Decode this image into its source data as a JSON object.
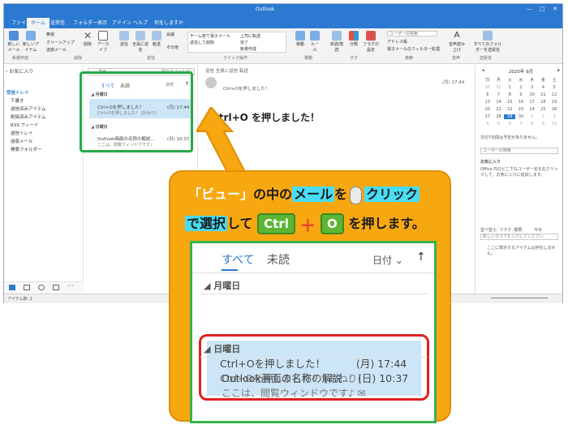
{
  "window": {
    "title": "Outlook",
    "controls": [
      "—",
      "□",
      "✕"
    ]
  },
  "tabs": [
    "ファイル",
    "ホーム",
    "送受信",
    "フォルダー",
    "表示",
    "アドイン",
    "ヘルプ",
    "何をしますか"
  ],
  "ribbon": {
    "new_mail": "新しいメール",
    "new_items": "新しいアイテム",
    "group_new": "新規作成",
    "ignore": "無視",
    "cleanup": "クリーンアップ",
    "junk": "迷惑メール",
    "delete": "削除",
    "archive": "アーカイブ",
    "group_delete": "削除",
    "reply": "返信",
    "reply_all": "全員に返信",
    "forward": "転送",
    "meeting": "会議",
    "more": "その他",
    "group_respond": "返信",
    "quick_to_manager": "上司に転送",
    "quick_team": "チーム宛て電子メール",
    "quick_done": "完了",
    "quick_reply_delete": "返信して削除",
    "quick_new": "新規作成",
    "group_quick": "クイック操作",
    "move": "移動",
    "rules": "ルール",
    "group_move": "移動",
    "unread": "未読/既読",
    "categorize": "分類",
    "followup": "フラグの設定",
    "group_tags": "タグ",
    "search_people": "ユーザーの検索",
    "address_book": "アドレス帳",
    "filter_email": "電子メールのフィルター処理",
    "group_find": "検索",
    "read_aloud": "音声読み上げ",
    "group_speech": "音声",
    "send_receive_all": "すべてのフォルダーを送受信",
    "group_send_receive": "送受信"
  },
  "folders": {
    "favorites": "お気に入り",
    "items": [
      "受信トレイ",
      "下書き",
      "送信済みアイテム",
      "削除済みアイテム",
      "RSS フィード",
      "送信トレイ",
      "迷惑メール",
      "検索フォルダー"
    ]
  },
  "status": {
    "items": "アイテム数: 2"
  },
  "message_list": {
    "search_placeholder": "検索",
    "search_scope": "現在のフォルダー",
    "filter_all": "すべて",
    "filter_unread": "未読",
    "sort_by": "日付",
    "groups": [
      {
        "label": "月曜日",
        "sender": "Ctrl+Oを押しました！",
        "preview": "Ctrl+Oを押しました！ [おわり]",
        "time": "(月) 17:44"
      },
      {
        "label": "日曜日",
        "sender": "Outlook画面の名称の解説…",
        "preview": "ここは、閲覧ウィンドウです♪",
        "time": "(日) 10:37"
      }
    ]
  },
  "reading": {
    "toolbar": "返信   全員に返信   転送",
    "from_line": "Ctrl+Oを押しました！",
    "date": "(月) 17:44",
    "subject": "Ctrl+O を押しました！"
  },
  "todo": {
    "calendar_header": "2020年 9月",
    "weekdays": [
      "日",
      "月",
      "火",
      "水",
      "木",
      "金",
      "土"
    ],
    "days": [
      "30",
      "31",
      "1",
      "2",
      "3",
      "4",
      "5",
      "6",
      "7",
      "8",
      "9",
      "10",
      "11",
      "12",
      "13",
      "14",
      "15",
      "16",
      "17",
      "18",
      "19",
      "20",
      "21",
      "22",
      "23",
      "24",
      "25",
      "26",
      "27",
      "28",
      "29",
      "30",
      "1",
      "2",
      "3",
      "4",
      "5",
      "6",
      "7",
      "8",
      "9",
      "10"
    ],
    "today_note": "次の7日間は予定がありません。",
    "people_search": "ユーザーの検索",
    "favorites_title": "お気に入り",
    "favorites_note": "Office 内のどこでもユーザー名を右クリックして、お気に入りに追加します。",
    "task_header": "並べ替え: フラグ: 期限",
    "task_today": "今日",
    "task_input_placeholder": "新しいタスクを入力してください",
    "task_empty": "ここに表示するアイテムは存在しません。"
  },
  "callout": {
    "line1_a": "「ビュー」",
    "line1_b": "の中の",
    "line1_c": "メール",
    "line1_d": "を",
    "line1_e": "クリック",
    "line2_a": "で選択",
    "line2_b": "して",
    "key1": "Ctrl",
    "key2": "O",
    "line2_c": "を押します。"
  },
  "zoom": {
    "filter_all": "すべて",
    "filter_unread": "未読",
    "sort_by": "日付",
    "group1": "月曜日",
    "m1_sender": "Ctrl+Oを押しました！",
    "m1_time": "(月) 17:44",
    "m1_preview": "Ctrl+Oを押しました！ [おわり]",
    "group2": "日曜日",
    "m2_sender": "Outlook画面の名称の解説...",
    "m2_time": "(日) 10:37",
    "m2_preview": "ここは、閲覧ウィンドウです♪"
  },
  "colors": {
    "accent": "#2b79d0",
    "callout_bg": "#f7a811",
    "highlight_cyan": "#49dcf5",
    "highlight_green": "#27a84a",
    "highlight_red": "#e02020"
  }
}
